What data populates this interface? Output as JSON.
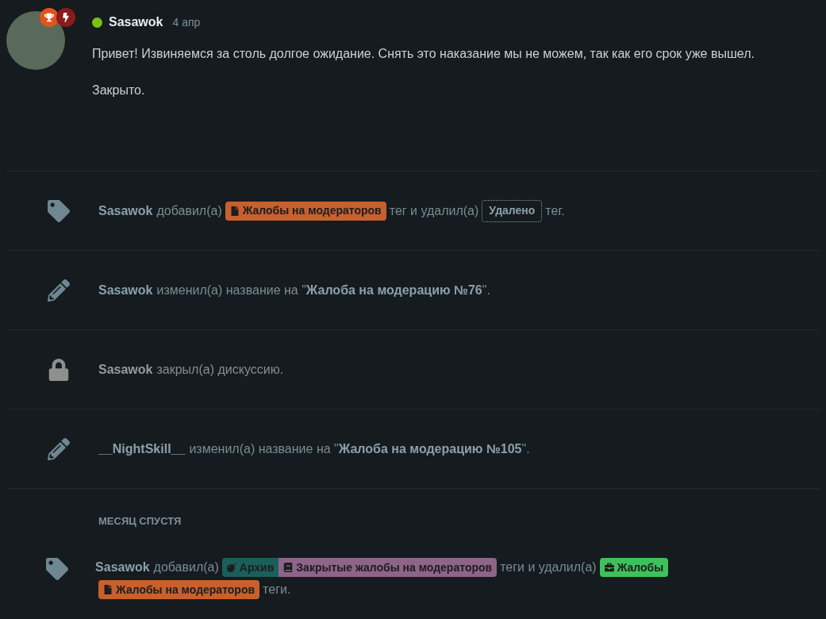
{
  "post": {
    "author": "Sasawok",
    "online": true,
    "date": "4 апр",
    "badges": [
      {
        "kind": "trophy",
        "color": "#e0531c"
      },
      {
        "kind": "bolt",
        "color": "#8b1a1a"
      }
    ],
    "paragraphs": [
      "Привет! Извиняемся за столь долгое ожидание. Снять это наказание мы не можем, так как его срок уже вышел.",
      "Закрыто."
    ]
  },
  "events": [
    {
      "kind": "tags",
      "user": "Sasawok",
      "parts": [
        {
          "kind": "text",
          "text": "добавил(а)"
        },
        {
          "kind": "tags",
          "tags": [
            {
              "kind": "file",
              "label": "Жалобы на модераторов",
              "color": "#c8602e"
            }
          ]
        },
        {
          "kind": "text",
          "text": "тег и удалил(а)"
        },
        {
          "kind": "removed",
          "label": "Удалено"
        },
        {
          "kind": "text",
          "text": "тег."
        }
      ]
    },
    {
      "kind": "rename",
      "user": "Sasawok",
      "parts": [
        {
          "kind": "text",
          "text": "изменил(а) название на \""
        },
        {
          "kind": "title",
          "text": "Жалоба на модерацию №76"
        },
        {
          "kind": "text",
          "text": "\"."
        }
      ]
    },
    {
      "kind": "lock",
      "user": "Sasawok",
      "parts": [
        {
          "kind": "text",
          "text": "закрыл(а) дискуссию."
        }
      ]
    },
    {
      "kind": "rename",
      "user": "__NightSkill__",
      "parts": [
        {
          "kind": "text",
          "text": "изменил(а) название на \""
        },
        {
          "kind": "title",
          "text": "Жалоба на модерацию №105"
        },
        {
          "kind": "text",
          "text": "\"."
        }
      ]
    },
    {
      "kind": "separator",
      "label": "МЕСЯЦ СПУСТЯ"
    },
    {
      "kind": "tags",
      "user": "Sasawok",
      "parts": [
        {
          "kind": "text",
          "text": "добавил(а)"
        },
        {
          "kind": "tags",
          "tags": [
            {
              "kind": "bomb",
              "label": "Архив",
              "color": "#1a5f5a"
            },
            {
              "kind": "book",
              "label": "Закрытые жалобы на модераторов",
              "color": "#8e6488"
            }
          ]
        },
        {
          "kind": "text",
          "text": "теги и удалил(а)"
        },
        {
          "kind": "tags",
          "tags": [
            {
              "kind": "briefcase",
              "label": "Жалобы",
              "color": "#3ec15a"
            }
          ]
        },
        {
          "kind": "tags",
          "tags": [
            {
              "kind": "file",
              "label": "Жалобы на модераторов",
              "color": "#c8602e"
            }
          ]
        },
        {
          "kind": "text",
          "text": "теги."
        }
      ]
    }
  ]
}
